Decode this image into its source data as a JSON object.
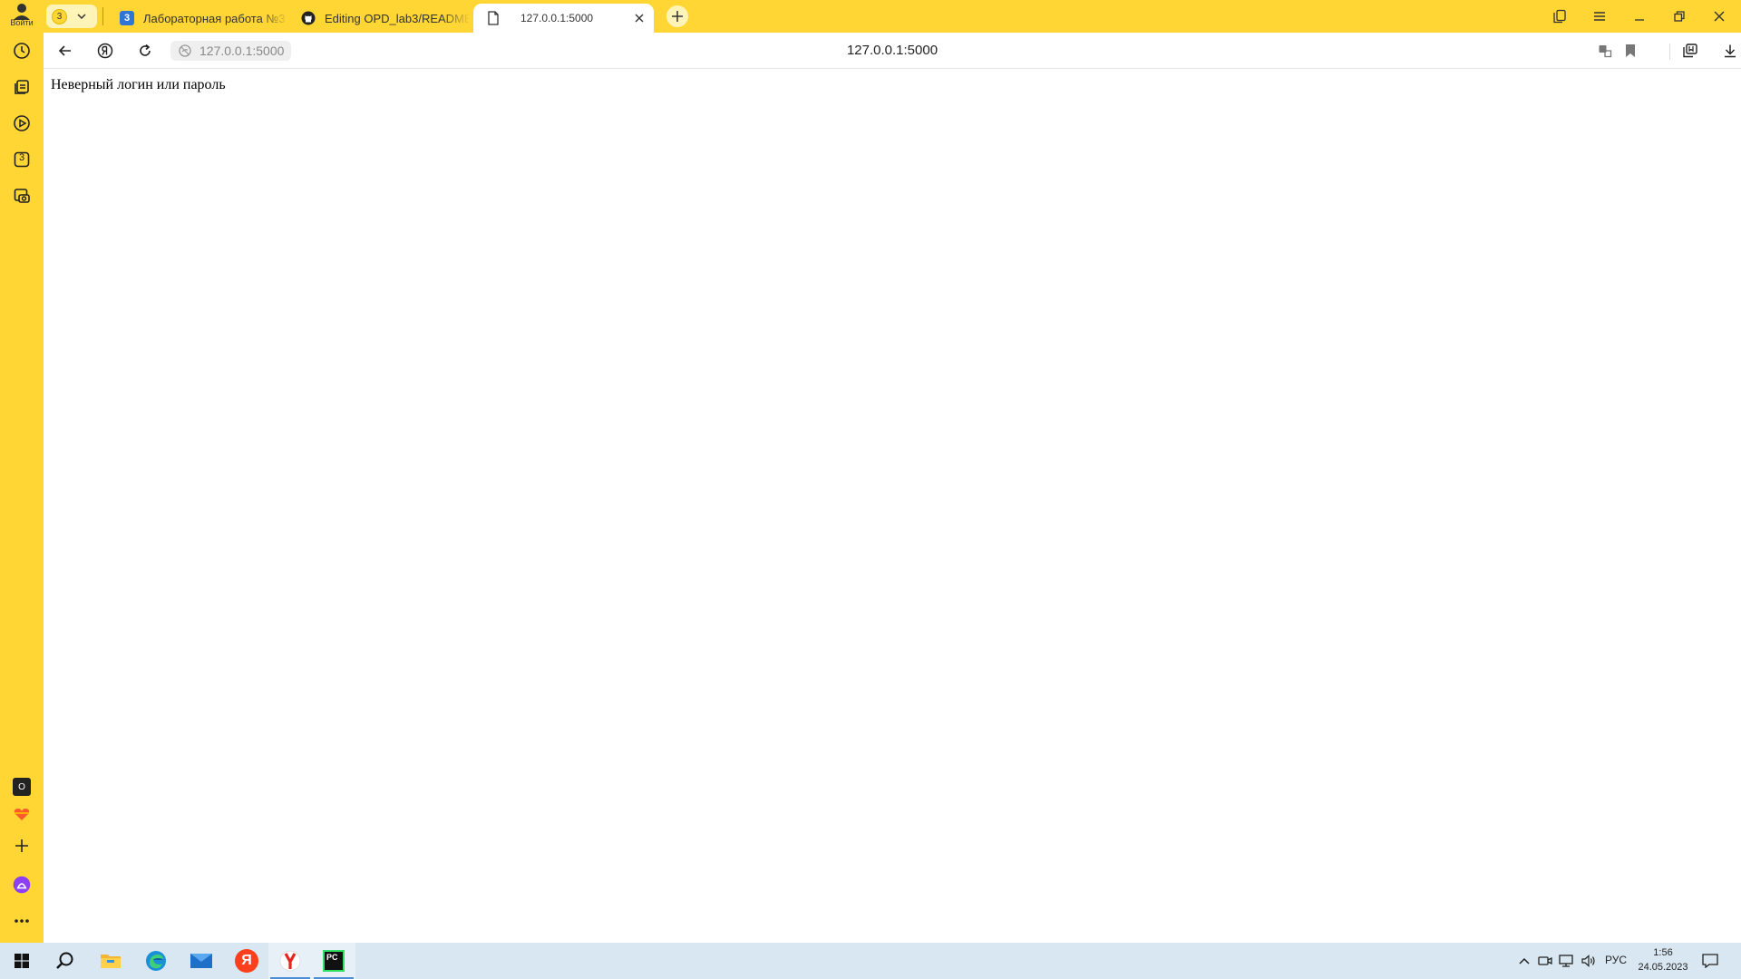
{
  "sidebar": {
    "login_label": "Войти",
    "counter_item": "3",
    "bottom_badge": "O"
  },
  "tabs": {
    "counter": "3",
    "items": [
      {
        "title": "Лабораторная работа №3",
        "favicon": "3"
      },
      {
        "title": "Editing OPD_lab3/README.md",
        "favicon": "github-icon"
      },
      {
        "title": "127.0.0.1:5000",
        "favicon": "page-icon",
        "active": true
      }
    ]
  },
  "addressbar": {
    "chip_url": "127.0.0.1:5000",
    "display_url": "127.0.0.1:5000"
  },
  "page": {
    "message": "Неверный логин или пароль"
  },
  "taskbar": {
    "lang": "РУС",
    "time": "1:56",
    "date": "24.05.2023",
    "yandex_letter": "Я",
    "pycharm_label": "PC"
  },
  "colors": {
    "yandex_yellow": "#ffd633",
    "taskbar": "#d8e7f1",
    "alice_purple": "#8c3ff5",
    "yandex_red": "#fc3f1d"
  }
}
